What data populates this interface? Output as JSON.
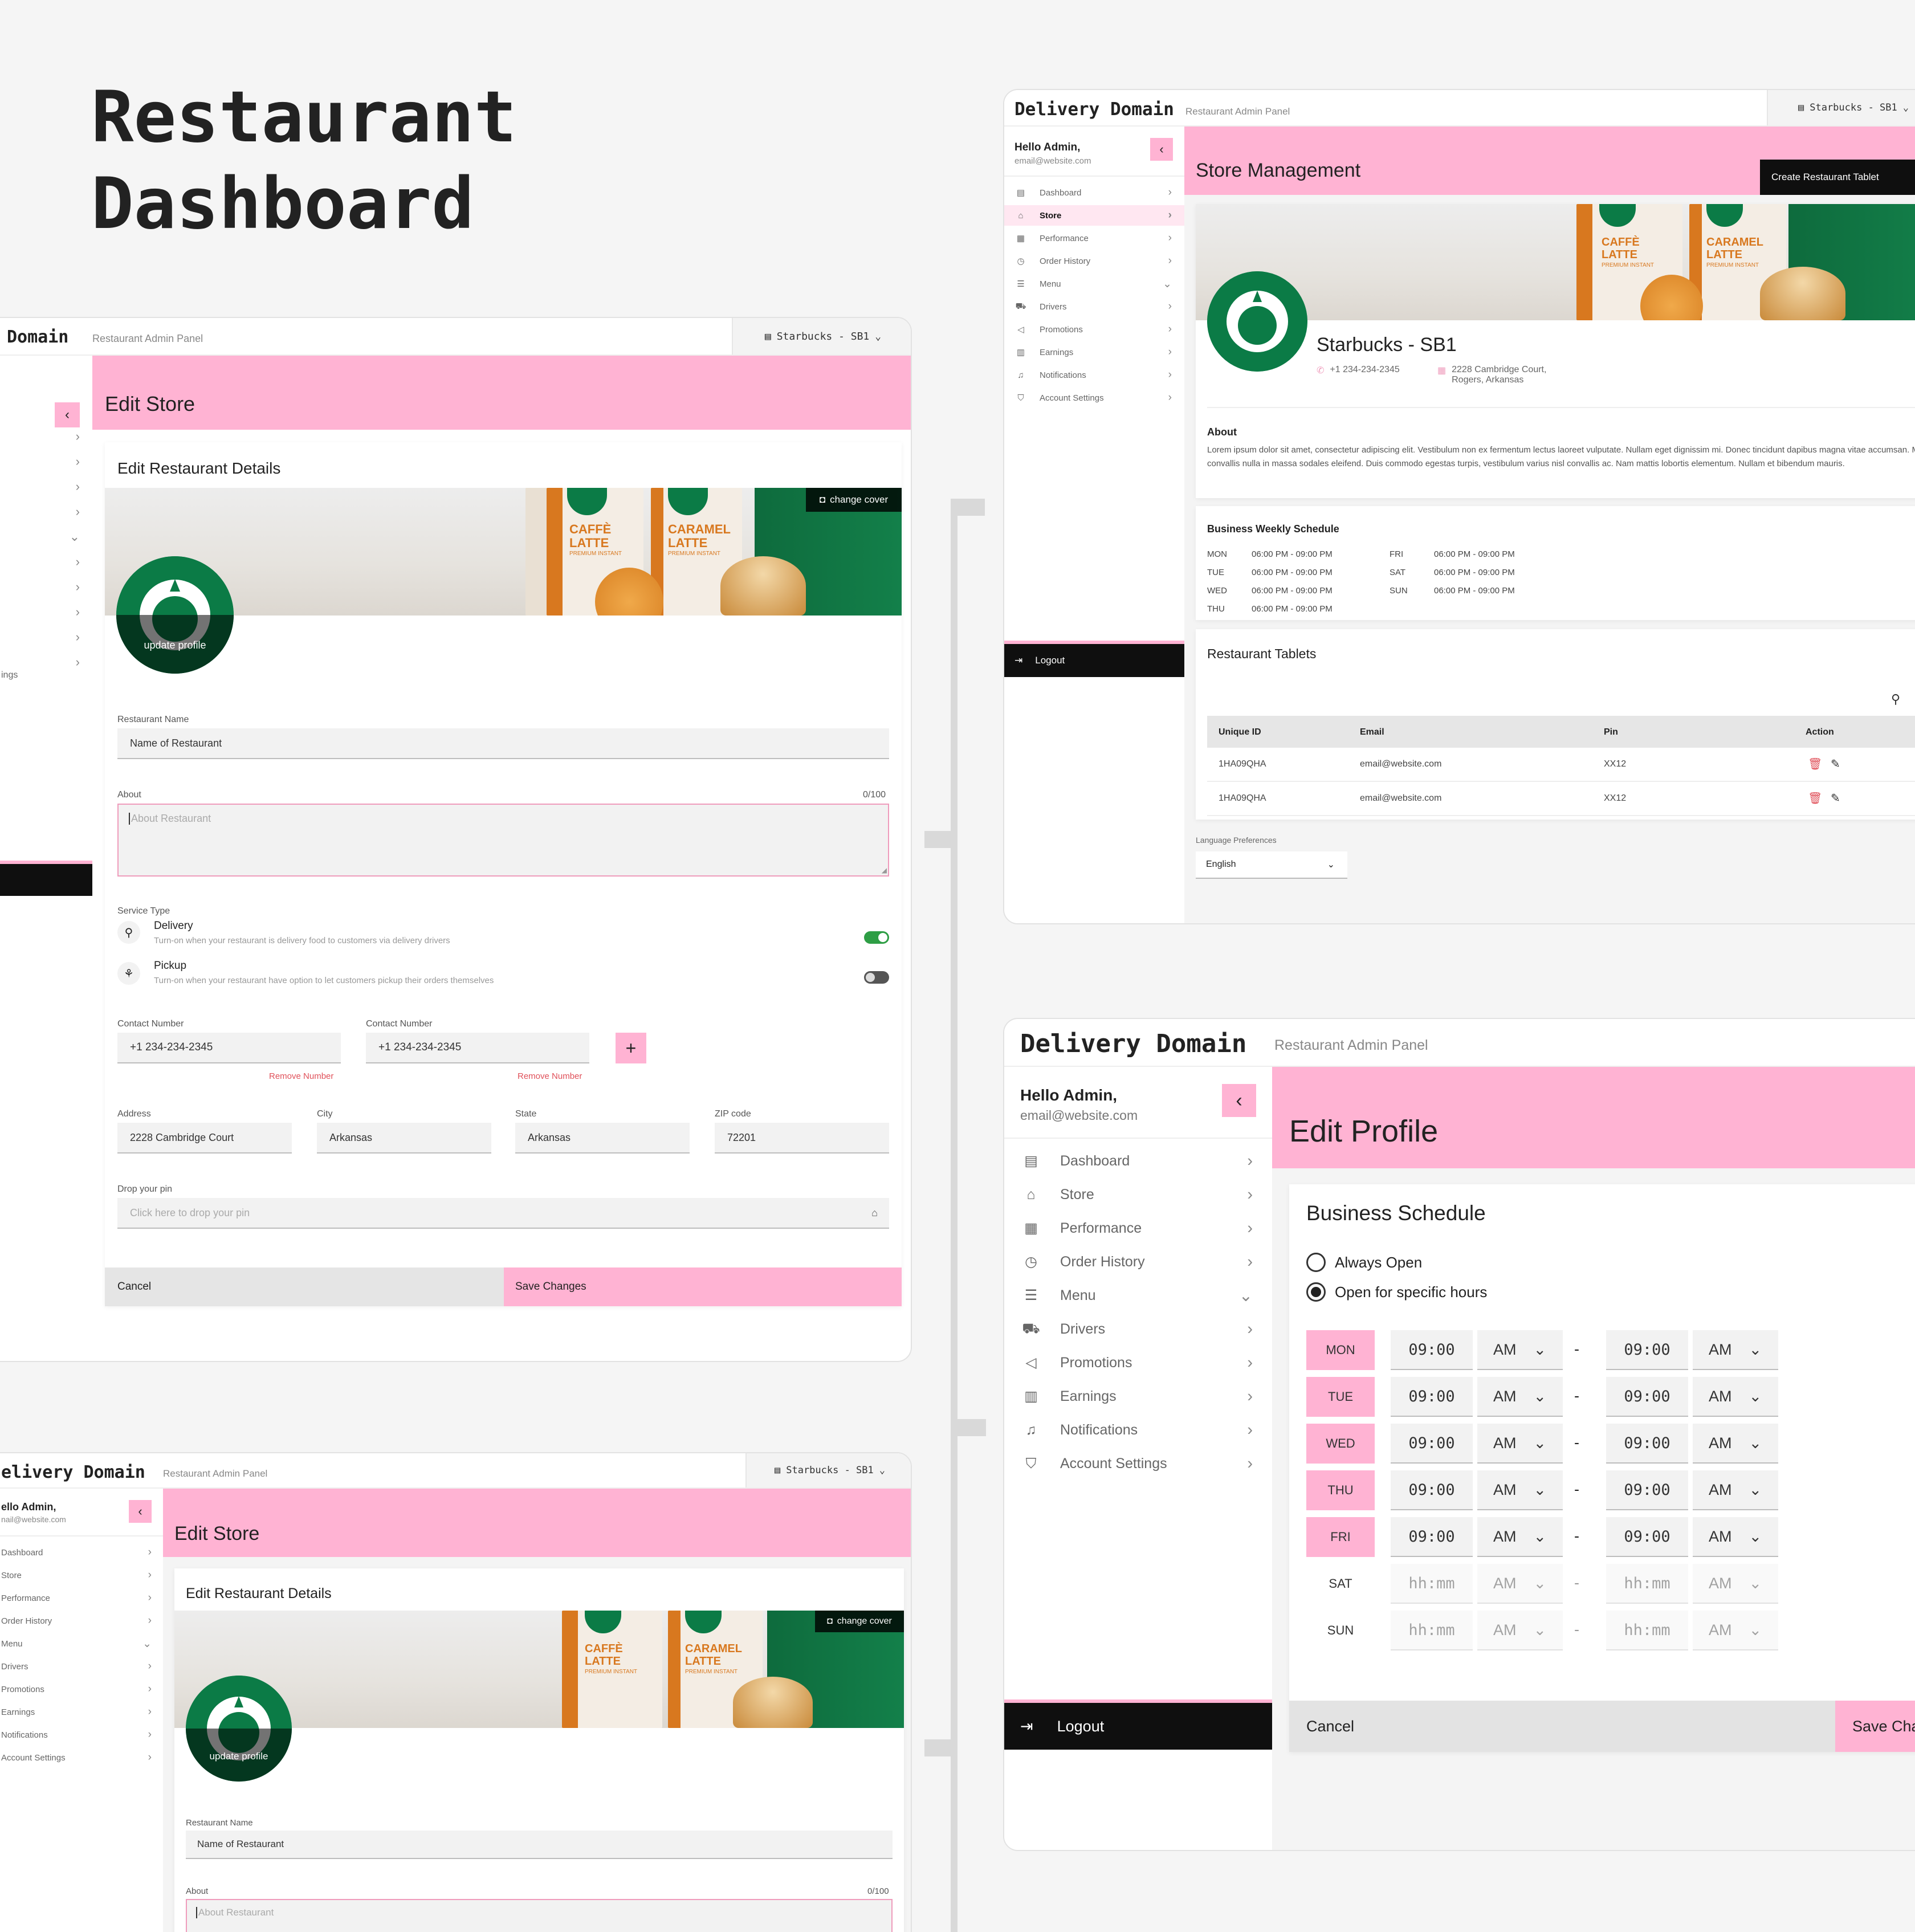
{
  "page": {
    "title_line1": "Restaurant",
    "title_line2": "Dashboard"
  },
  "app": {
    "brand": "Delivery Domain",
    "brand_partial": "Domain",
    "brand_partial2": "elivery Domain",
    "subtitle": "Restaurant Admin Panel",
    "store_selector": "Starbucks - SB1",
    "greeting": "Hello Admin,",
    "email": "email@website.com",
    "greeting_partial": "ello Admin,",
    "email_partial": "nail@website.com",
    "logout": "Logout"
  },
  "nav": [
    {
      "label": "Dashboard",
      "icon": "dashboard-icon",
      "chev": "›"
    },
    {
      "label": "Store",
      "icon": "store-icon",
      "chev": "›"
    },
    {
      "label": "Performance",
      "icon": "performance-icon",
      "chev": "›"
    },
    {
      "label": "Order History",
      "icon": "order-history-icon",
      "chev": "›"
    },
    {
      "label": "Menu",
      "icon": "menu-icon",
      "chev": "⌄"
    },
    {
      "label": "Drivers",
      "icon": "drivers-icon",
      "chev": "›"
    },
    {
      "label": "Promotions",
      "icon": "promotions-icon",
      "chev": "›"
    },
    {
      "label": "Earnings",
      "icon": "earnings-icon",
      "chev": "›"
    },
    {
      "label": "Notifications",
      "icon": "notifications-icon",
      "chev": "›"
    },
    {
      "label": "Account Settings",
      "icon": "account-settings-icon",
      "chev": "›"
    }
  ],
  "nav_partial": {
    "account_settings": "ings"
  },
  "edit_store": {
    "header": "Edit Store",
    "card_title": "Edit Restaurant Details",
    "change_cover": "change cover",
    "update_profile": "update profile",
    "restaurant_name_label": "Restaurant Name",
    "restaurant_name_value": "Name of Restaurant",
    "about_label": "About",
    "about_counter": "0/100",
    "about_placeholder": "About Restaurant",
    "service_type_label": "Service Type",
    "delivery_title": "Delivery",
    "delivery_desc": "Turn-on when your restaurant is delivery food to customers via delivery drivers",
    "pickup_title": "Pickup",
    "pickup_desc": "Turn-on when your restaurant have option to let customers pickup their orders themselves",
    "contact_label": "Contact Number",
    "contact_value": "+1 234-234-2345",
    "remove_number": "Remove Number",
    "add_symbol": "+",
    "address_label": "Address",
    "address_value": "2228 Cambridge Court",
    "city_label": "City",
    "city_value": "Arkansas",
    "state_label": "State",
    "state_value": "Arkansas",
    "zip_label": "ZIP code",
    "zip_value": "72201",
    "pin_label": "Drop your pin",
    "pin_placeholder": "Click here to drop your pin",
    "cancel": "Cancel",
    "save": "Save Changes"
  },
  "store_mgmt": {
    "header": "Store Management",
    "create_tablet": "Create Restaurant Tablet",
    "store_name": "Starbucks - SB1",
    "phone": "+1 234-234-2345",
    "address_line1": "2228 Cambridge Court,",
    "address_line2": "Rogers, Arkansas",
    "about_title": "About",
    "about_text": "Lorem ipsum dolor sit amet, consectetur adipiscing elit. Vestibulum non ex fermentum lectus laoreet vulputate. Nullam eget dignissim mi. Donec tincidunt dapibus magna vitae accumsan. Mauris convallis nulla in massa sodales eleifend. Duis commodo egestas turpis, vestibulum varius nisl convallis ac. Nam mattis lobortis elementum. Nullam et bibendum mauris.",
    "schedule_title": "Business Weekly Schedule",
    "schedule": [
      {
        "day": "MON",
        "hours": "06:00 PM - 09:00 PM"
      },
      {
        "day": "TUE",
        "hours": "06:00 PM - 09:00 PM"
      },
      {
        "day": "WED",
        "hours": "06:00 PM - 09:00 PM"
      },
      {
        "day": "THU",
        "hours": "06:00 PM - 09:00 PM"
      },
      {
        "day": "FRI",
        "hours": "06:00 PM - 09:00 PM"
      },
      {
        "day": "SAT",
        "hours": "06:00 PM - 09:00 PM"
      },
      {
        "day": "SUN",
        "hours": "06:00 PM - 09:00 PM"
      }
    ],
    "tablets_title": "Restaurant Tablets",
    "table_headers": [
      "Unique ID",
      "Email",
      "Pin",
      "Action"
    ],
    "table_rows": [
      [
        "1HA09QHA",
        "email@website.com",
        "XX12"
      ],
      [
        "1HA09QHA",
        "email@website.com",
        "XX12"
      ]
    ],
    "lang_label": "Language Preferences",
    "lang_value": "English"
  },
  "edit_profile": {
    "header": "Edit Profile",
    "schedule_title": "Business Schedule",
    "always_open": "Always Open",
    "specific_hours": "Open for specific hours",
    "days": [
      {
        "day": "MON",
        "start": "09:00",
        "start_ampm": "AM",
        "end": "09:00",
        "end_ampm": "AM",
        "active": true
      },
      {
        "day": "TUE",
        "start": "09:00",
        "start_ampm": "AM",
        "end": "09:00",
        "end_ampm": "AM",
        "active": true
      },
      {
        "day": "WED",
        "start": "09:00",
        "start_ampm": "AM",
        "end": "09:00",
        "end_ampm": "AM",
        "active": true
      },
      {
        "day": "THU",
        "start": "09:00",
        "start_ampm": "AM",
        "end": "09:00",
        "end_ampm": "AM",
        "active": true
      },
      {
        "day": "FRI",
        "start": "09:00",
        "start_ampm": "AM",
        "end": "09:00",
        "end_ampm": "AM",
        "active": true
      },
      {
        "day": "SAT",
        "start": "hh:mm",
        "start_ampm": "AM",
        "end": "hh:mm",
        "end_ampm": "AM",
        "active": false
      },
      {
        "day": "SUN",
        "start": "hh:mm",
        "start_ampm": "AM",
        "end": "hh:mm",
        "end_ampm": "AM",
        "active": false
      }
    ],
    "dash": "-",
    "cancel": "Cancel",
    "save": "Save Char"
  },
  "cover_art": {
    "box1_line1": "CAFFÈ",
    "box1_line2": "LATTE",
    "box1_tag": "PREMIUM INSTANT",
    "box2_line1": "CARAMEL",
    "box2_line2": "LATTE",
    "box2_tag": "PREMIUM INSTANT"
  },
  "colors": {
    "accent": "#ffb3d3",
    "dark": "#0f0f0f",
    "toggle_on": "#2e9e45",
    "danger": "#e0515a",
    "brand_green": "#0b7b46"
  }
}
